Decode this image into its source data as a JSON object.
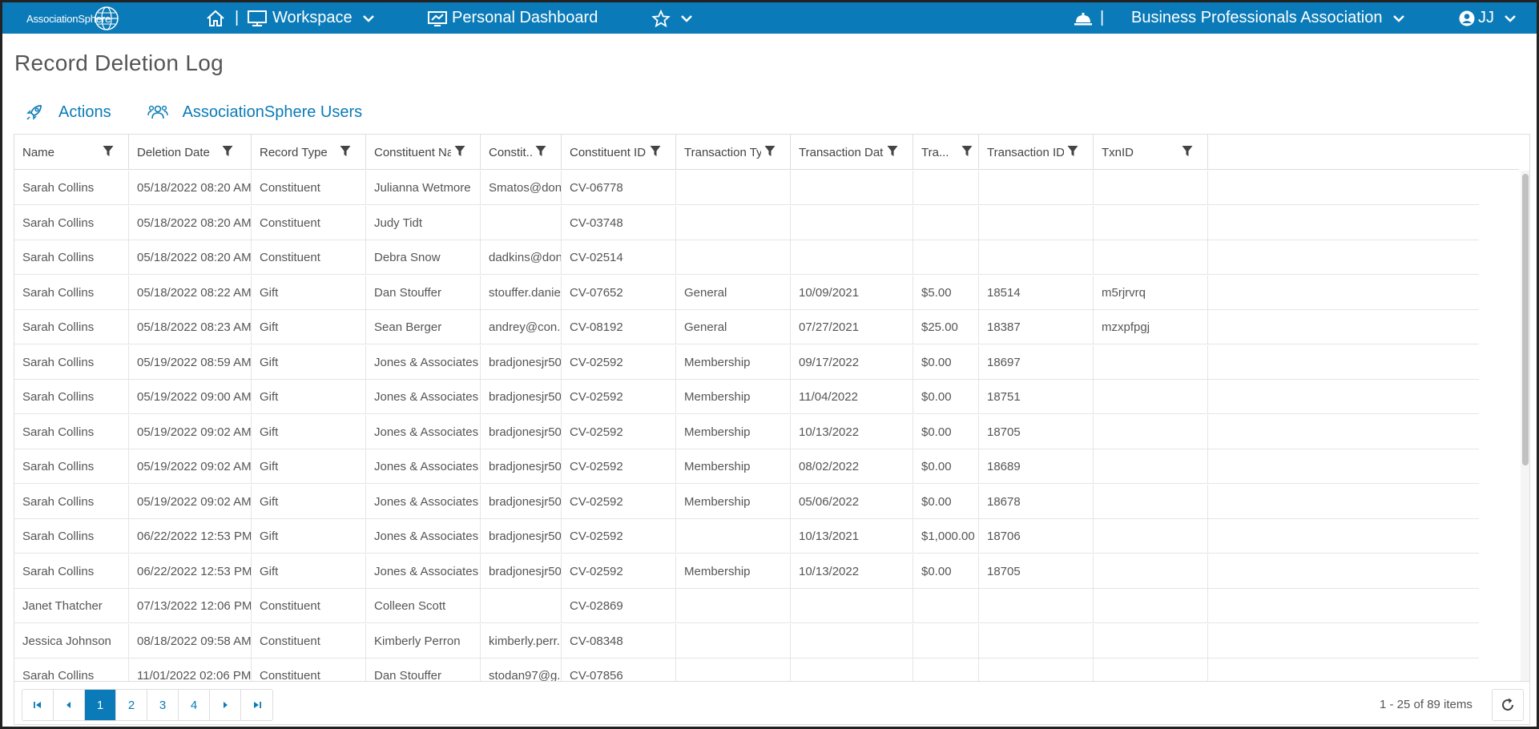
{
  "header": {
    "logo_text": "AssociationSphere",
    "workspace_label": "Workspace",
    "dashboard_label": "Personal Dashboard",
    "separator": "|",
    "org_name": "Business Professionals Association",
    "user_initials": "JJ"
  },
  "page": {
    "title": "Record Deletion Log"
  },
  "toolbar": {
    "actions_label": "Actions",
    "users_label": "AssociationSphere Users"
  },
  "grid": {
    "columns": [
      "Name",
      "Deletion Date",
      "Record Type",
      "Constituent Na...",
      "Constit...",
      "Constituent ID",
      "Transaction Type",
      "Transaction Date",
      "Tra...",
      "Transaction ID",
      "TxnID"
    ],
    "rows": [
      [
        "Sarah Collins",
        "05/18/2022 08:20 AM",
        "Constituent",
        "Julianna Wetmore",
        "Smatos@don...",
        "CV-06778",
        "",
        "",
        "",
        "",
        ""
      ],
      [
        "Sarah Collins",
        "05/18/2022 08:20 AM",
        "Constituent",
        "Judy Tidt",
        "",
        "CV-03748",
        "",
        "",
        "",
        "",
        ""
      ],
      [
        "Sarah Collins",
        "05/18/2022 08:20 AM",
        "Constituent",
        "Debra Snow",
        "dadkins@don...",
        "CV-02514",
        "",
        "",
        "",
        "",
        ""
      ],
      [
        "Sarah Collins",
        "05/18/2022 08:22 AM",
        "Gift",
        "Dan Stouffer",
        "stouffer.danie...",
        "CV-07652",
        "General",
        "10/09/2021",
        "$5.00",
        "18514",
        "m5rjrvrq"
      ],
      [
        "Sarah Collins",
        "05/18/2022 08:23 AM",
        "Gift",
        "Sean Berger",
        "andrey@con...",
        "CV-08192",
        "General",
        "07/27/2021",
        "$25.00",
        "18387",
        "mzxpfpgj"
      ],
      [
        "Sarah Collins",
        "05/19/2022 08:59 AM",
        "Gift",
        "Jones & Associates LLP",
        "bradjonesjr50...",
        "CV-02592",
        "Membership",
        "09/17/2022",
        "$0.00",
        "18697",
        ""
      ],
      [
        "Sarah Collins",
        "05/19/2022 09:00 AM",
        "Gift",
        "Jones & Associates LLP",
        "bradjonesjr50...",
        "CV-02592",
        "Membership",
        "11/04/2022",
        "$0.00",
        "18751",
        ""
      ],
      [
        "Sarah Collins",
        "05/19/2022 09:02 AM",
        "Gift",
        "Jones & Associates LLP",
        "bradjonesjr50...",
        "CV-02592",
        "Membership",
        "10/13/2022",
        "$0.00",
        "18705",
        ""
      ],
      [
        "Sarah Collins",
        "05/19/2022 09:02 AM",
        "Gift",
        "Jones & Associates LLP",
        "bradjonesjr50...",
        "CV-02592",
        "Membership",
        "08/02/2022",
        "$0.00",
        "18689",
        ""
      ],
      [
        "Sarah Collins",
        "05/19/2022 09:02 AM",
        "Gift",
        "Jones & Associates LLP",
        "bradjonesjr50...",
        "CV-02592",
        "Membership",
        "05/06/2022",
        "$0.00",
        "18678",
        ""
      ],
      [
        "Sarah Collins",
        "06/22/2022 12:53 PM",
        "Gift",
        "Jones & Associates LLP",
        "bradjonesjr50...",
        "CV-02592",
        "",
        "10/13/2021",
        "$1,000.00",
        "18706",
        ""
      ],
      [
        "Sarah Collins",
        "06/22/2022 12:53 PM",
        "Gift",
        "Jones & Associates LLP",
        "bradjonesjr50...",
        "CV-02592",
        "Membership",
        "10/13/2022",
        "$0.00",
        "18705",
        ""
      ],
      [
        "Janet Thatcher",
        "07/13/2022 12:06 PM",
        "Constituent",
        "Colleen Scott",
        "",
        "CV-02869",
        "",
        "",
        "",
        "",
        ""
      ],
      [
        "Jessica Johnson",
        "08/18/2022 09:58 AM",
        "Constituent",
        "Kimberly Perron",
        "kimberly.perr...",
        "CV-08348",
        "",
        "",
        "",
        "",
        ""
      ],
      [
        "Sarah Collins",
        "11/01/2022 02:06 PM",
        "Constituent",
        "Dan Stouffer",
        "stodan97@g...",
        "CV-07856",
        "",
        "",
        "",
        "",
        ""
      ]
    ]
  },
  "pager": {
    "pages": [
      "1",
      "2",
      "3",
      "4"
    ],
    "current_page": "1",
    "info": "1 - 25 of 89 items"
  },
  "colors": {
    "brand": "#0a7bb8",
    "header_text": "#ffffff",
    "grid_text": "#555555"
  }
}
